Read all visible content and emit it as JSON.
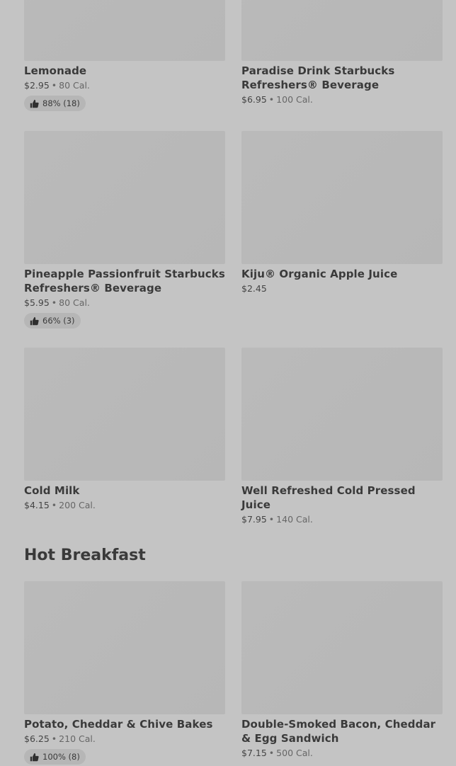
{
  "items_top": [
    {
      "name": "Lemonade",
      "price": "$2.95",
      "cal": "80 Cal.",
      "rating": "88% (18)"
    },
    {
      "name": "Paradise Drink Starbucks Refreshers® Beverage",
      "price": "$6.95",
      "cal": "100 Cal.",
      "rating": null
    },
    {
      "name": "Pineapple Passionfruit Starbucks Refreshers® Beverage",
      "price": "$5.95",
      "cal": "80 Cal.",
      "rating": "66% (3)"
    },
    {
      "name": "Kiju® Organic Apple Juice",
      "price": "$2.45",
      "cal": null,
      "rating": null
    },
    {
      "name": "Cold Milk",
      "price": "$4.15",
      "cal": "200 Cal.",
      "rating": null
    },
    {
      "name": "Well Refreshed Cold Pressed Juice",
      "price": "$7.95",
      "cal": "140 Cal.",
      "rating": null
    }
  ],
  "section": {
    "title": "Hot Breakfast"
  },
  "items_bottom": [
    {
      "name": "Potato, Cheddar & Chive Bakes",
      "price": "$6.25",
      "cal": "210 Cal.",
      "rating": "100% (8)"
    },
    {
      "name": "Double-Smoked Bacon, Cheddar & Egg Sandwich",
      "price": "$7.15",
      "cal": "500 Cal.",
      "rating": null
    }
  ],
  "separator": "•",
  "icons": {
    "rating": "thumbs-up-icon"
  }
}
